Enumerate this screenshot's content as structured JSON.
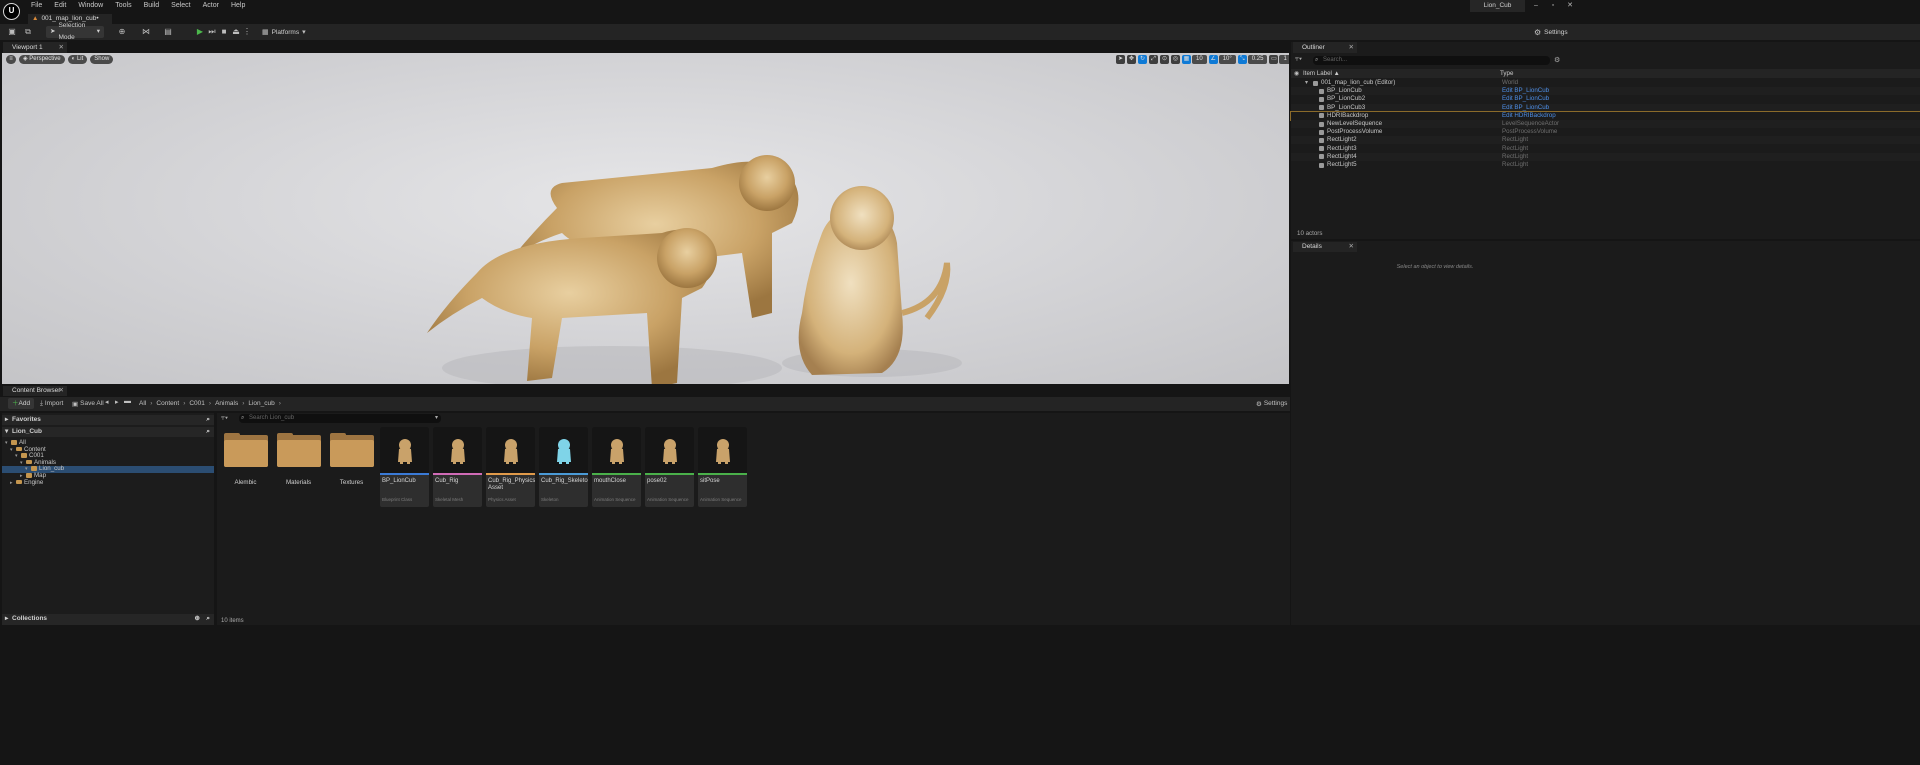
{
  "menu": [
    "File",
    "Edit",
    "Window",
    "Tools",
    "Build",
    "Select",
    "Actor",
    "Help"
  ],
  "logo_text": "U",
  "document_tab": "001_map_lion_cub•",
  "project_name": "Lion_Cub",
  "window_controls": {
    "minimize": "–",
    "maximize": "▫",
    "close": "✕"
  },
  "toolbar": {
    "selection_mode": "Selection Mode",
    "platforms": "Platforms",
    "settings": "Settings"
  },
  "viewport": {
    "tab_label": "Viewport 1",
    "perspective": "Perspective",
    "lit": "Lit",
    "show": "Show",
    "grid_snap": "10",
    "rotation_snap": "10°",
    "scale_snap": "0.25",
    "camera_speed": "1"
  },
  "outliner": {
    "tab_label": "Outliner",
    "search_placeholder": "Search...",
    "col_label": "Item Label ▲",
    "col_type": "Type",
    "rows": [
      {
        "label": "001_map_lion_cub (Editor)",
        "type": "World",
        "link": false
      },
      {
        "label": "BP_LionCub",
        "type": "Edit BP_LionCub",
        "link": true
      },
      {
        "label": "BP_LionCub2",
        "type": "Edit BP_LionCub",
        "link": true
      },
      {
        "label": "BP_LionCub3",
        "type": "Edit BP_LionCub",
        "link": true
      },
      {
        "label": "HDRIBackdrop",
        "type": "Edit HDRIBackdrop",
        "link": true
      },
      {
        "label": "NewLevelSequence",
        "type": "LevelSequenceActor",
        "link": false
      },
      {
        "label": "PostProcessVolume",
        "type": "PostProcessVolume",
        "link": false
      },
      {
        "label": "RectLight2",
        "type": "RectLight",
        "link": false
      },
      {
        "label": "RectLight3",
        "type": "RectLight",
        "link": false
      },
      {
        "label": "RectLight4",
        "type": "RectLight",
        "link": false
      },
      {
        "label": "RectLight5",
        "type": "RectLight",
        "link": false
      }
    ],
    "count": "10 actors"
  },
  "details": {
    "tab_label": "Details",
    "empty_message": "Select an object to view details."
  },
  "content_browser": {
    "tab_label": "Content Browser",
    "add": "Add",
    "import": "Import",
    "save_all": "Save All",
    "breadcrumb": [
      "All",
      "Content",
      "C001",
      "Animals",
      "Lion_cub"
    ],
    "settings": "Settings",
    "favorites": "Favorites",
    "root": "Lion_Cub",
    "tree": [
      {
        "label": "All",
        "depth": 0,
        "selected": false
      },
      {
        "label": "Content",
        "depth": 1,
        "selected": false
      },
      {
        "label": "C001",
        "depth": 2,
        "selected": false
      },
      {
        "label": "Animals",
        "depth": 3,
        "selected": false
      },
      {
        "label": "Lion_cub",
        "depth": 4,
        "selected": true
      },
      {
        "label": "Map",
        "depth": 3,
        "selected": false
      },
      {
        "label": "Engine",
        "depth": 1,
        "selected": false
      }
    ],
    "search_placeholder": "Search Lion_cub",
    "folders": [
      "Alembic",
      "Materials",
      "Textures"
    ],
    "assets": [
      {
        "name": "BP_LionCub",
        "type": "Blueprint Class",
        "color": "#3a7ad6",
        "icon": "lion-cub-thumbnail"
      },
      {
        "name": "Cub_Rig",
        "type": "Skeletal Mesh",
        "color": "#d06bb6",
        "icon": "lion-cub-thumbnail"
      },
      {
        "name": "Cub_Rig_Physics Asset",
        "type": "Physics Asset",
        "color": "#e09a4a",
        "icon": "lion-cub-thumbnail"
      },
      {
        "name": "Cub_Rig_Skeleton",
        "type": "Skeleton",
        "color": "#4a9ad6",
        "icon": "skeleton-thumbnail"
      },
      {
        "name": "mouthClose",
        "type": "Animation Sequence",
        "color": "#4ab04a",
        "icon": "lion-cub-thumbnail"
      },
      {
        "name": "pose02",
        "type": "Animation Sequence",
        "color": "#4ab04a",
        "icon": "lion-cub-thumbnail"
      },
      {
        "name": "sitPose",
        "type": "Animation Sequence",
        "color": "#4ab04a",
        "icon": "lion-cub-thumbnail"
      }
    ],
    "item_count": "10 items",
    "collections": "Collections"
  },
  "colors": {
    "accent_blue": "#0e7ad6",
    "link_blue": "#4e8fe8",
    "play_green": "#4cb84c",
    "folder": "#c99a5a"
  }
}
